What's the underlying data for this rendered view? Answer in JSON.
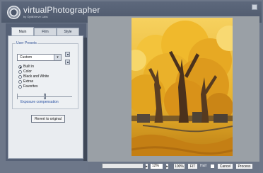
{
  "app": {
    "title": "virtualPhotographer",
    "subtitle": "by OptikVerve Labs"
  },
  "tabs": [
    "Main",
    "Film",
    "Style"
  ],
  "presets": {
    "group_label": "User Presets",
    "selected": "Custom",
    "options": [
      "Built in",
      "Color",
      "Black and White",
      "Extras",
      "Favorites"
    ],
    "checked_index": 0
  },
  "exposure": {
    "label": "Exposure compensation",
    "value_fraction": 0.5
  },
  "buttons": {
    "revert": "Revert to original",
    "fit": "FIT",
    "cancel": "Cancel",
    "process": "Process"
  },
  "zoom": {
    "value": "12%",
    "hundred": "100%",
    "half_label": "Half"
  },
  "icons": {
    "zoom_minus": "▸",
    "zoom_plus": "▸",
    "dropdown": "▾"
  }
}
